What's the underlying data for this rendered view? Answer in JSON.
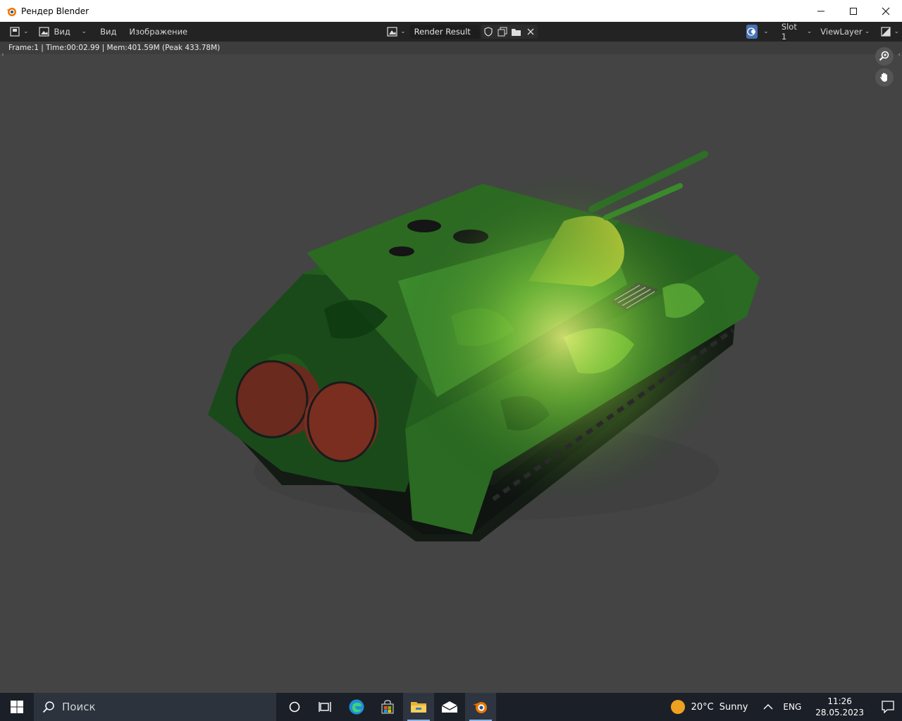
{
  "window": {
    "title": "Рендер Blender",
    "controls": {
      "minimize": "minimize",
      "maximize": "maximize",
      "close": "close"
    }
  },
  "header": {
    "view_dropdown_label": "Вид",
    "menu_view": "Вид",
    "menu_image": "Изображение",
    "image_name": "Render Result",
    "slot": "Slot 1",
    "view_layer": "ViewLayer"
  },
  "viewport": {
    "stats": "Frame:1 | Time:00:02.99 | Mem:401.59M (Peak 433.78M)",
    "background_color": "#444444"
  },
  "render": {
    "subject": "tank",
    "colors": {
      "camo_dark": "#1e5a1e",
      "camo_light": "#4caa2e",
      "highlight": "#d8e640",
      "barrel_end": "#7a2a20"
    }
  },
  "taskbar": {
    "search_placeholder": "Поиск",
    "weather": {
      "temp": "20°C",
      "condition": "Sunny"
    },
    "language": "ENG",
    "time": "11:26",
    "date": "28.05.2023"
  }
}
